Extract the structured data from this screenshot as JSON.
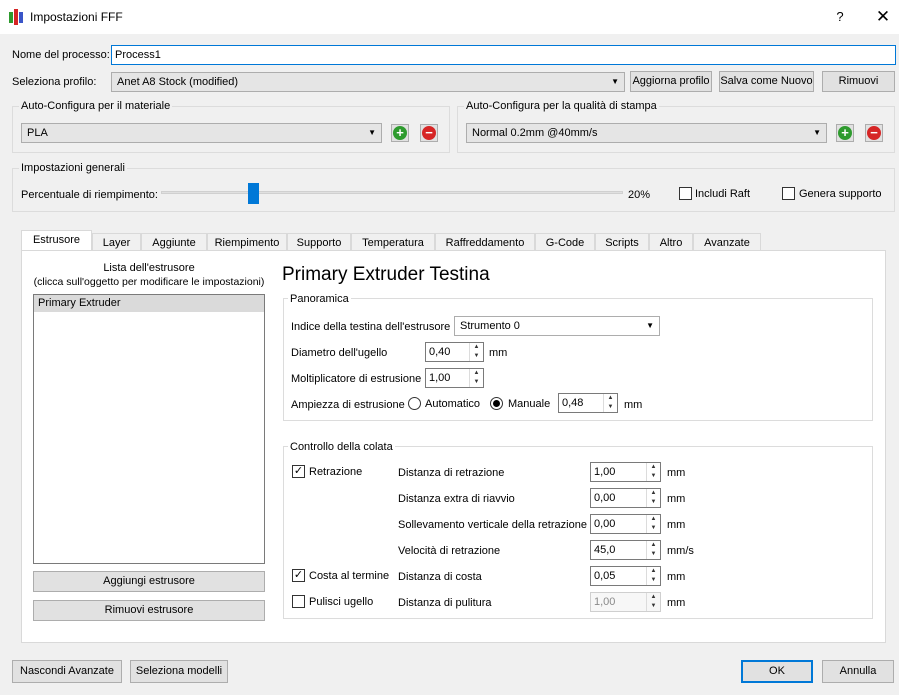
{
  "window": {
    "title": "Impostazioni FFF",
    "help": "?",
    "close": "✕"
  },
  "process": {
    "label": "Nome del processo:",
    "value": "Process1"
  },
  "profile": {
    "label": "Seleziona profilo:",
    "selected": "Anet A8 Stock (modified)",
    "update_btn": "Aggiorna profilo",
    "save_new_btn": "Salva come Nuovo",
    "remove_btn": "Rimuovi"
  },
  "material": {
    "title": "Auto-Configura per il materiale",
    "selected": "PLA"
  },
  "quality": {
    "title": "Auto-Configura per la qualità di stampa",
    "selected": "Normal 0.2mm @40mm/s"
  },
  "general": {
    "title": "Impostazioni generali",
    "infill_label": "Percentuale di riempimento:",
    "infill_value": "20%",
    "infill_fraction": 0.2,
    "raft_label": "Includi Raft",
    "support_label": "Genera supporto"
  },
  "tabs": [
    "Estrusore",
    "Layer",
    "Aggiunte",
    "Riempimento",
    "Supporto",
    "Temperatura",
    "Raffreddamento",
    "G-Code",
    "Scripts",
    "Altro",
    "Avanzate"
  ],
  "extruder_list": {
    "header_line1": "Lista dell'estrusore",
    "header_line2": "(clicca sull'oggetto per modificare le impostazioni)",
    "items": [
      "Primary Extruder"
    ],
    "add_btn": "Aggiungi estrusore",
    "remove_btn": "Rimuovi estrusore"
  },
  "extruder": {
    "heading": "Primary Extruder Testina",
    "overview": {
      "title": "Panoramica",
      "head_index_label": "Indice della testina dell'estrusore",
      "head_index_value": "Strumento 0",
      "nozzle_label": "Diametro dell'ugello",
      "nozzle_value": "0,40",
      "nozzle_unit": "mm",
      "multiplier_label": "Moltiplicatore di estrusione",
      "multiplier_value": "1,00",
      "width_label": "Ampiezza di estrusione",
      "width_auto": "Automatico",
      "width_manual": "Manuale",
      "width_value": "0,48",
      "width_unit": "mm"
    },
    "ooze": {
      "title": "Controllo della colata",
      "retraction_label": "Retrazione",
      "coast_label": "Costa al termine",
      "wipe_label": "Pulisci ugello",
      "rows": [
        {
          "label": "Distanza di retrazione",
          "value": "1,00",
          "unit": "mm"
        },
        {
          "label": "Distanza extra di riavvio",
          "value": "0,00",
          "unit": "mm"
        },
        {
          "label": "Sollevamento verticale della retrazione",
          "value": "0,00",
          "unit": "mm"
        },
        {
          "label": "Velocità di retrazione",
          "value": "45,0",
          "unit": "mm/s"
        },
        {
          "label": "Distanza di costa",
          "value": "0,05",
          "unit": "mm"
        },
        {
          "label": "Distanza di pulitura",
          "value": "1,00",
          "unit": "mm"
        }
      ]
    }
  },
  "footer": {
    "hide_advanced": "Nascondi Avanzate",
    "select_models": "Seleziona modelli",
    "ok": "OK",
    "cancel": "Annulla"
  },
  "colors": {
    "accent": "#0078d7",
    "add": "#2e9b2e",
    "remove": "#d62525"
  }
}
